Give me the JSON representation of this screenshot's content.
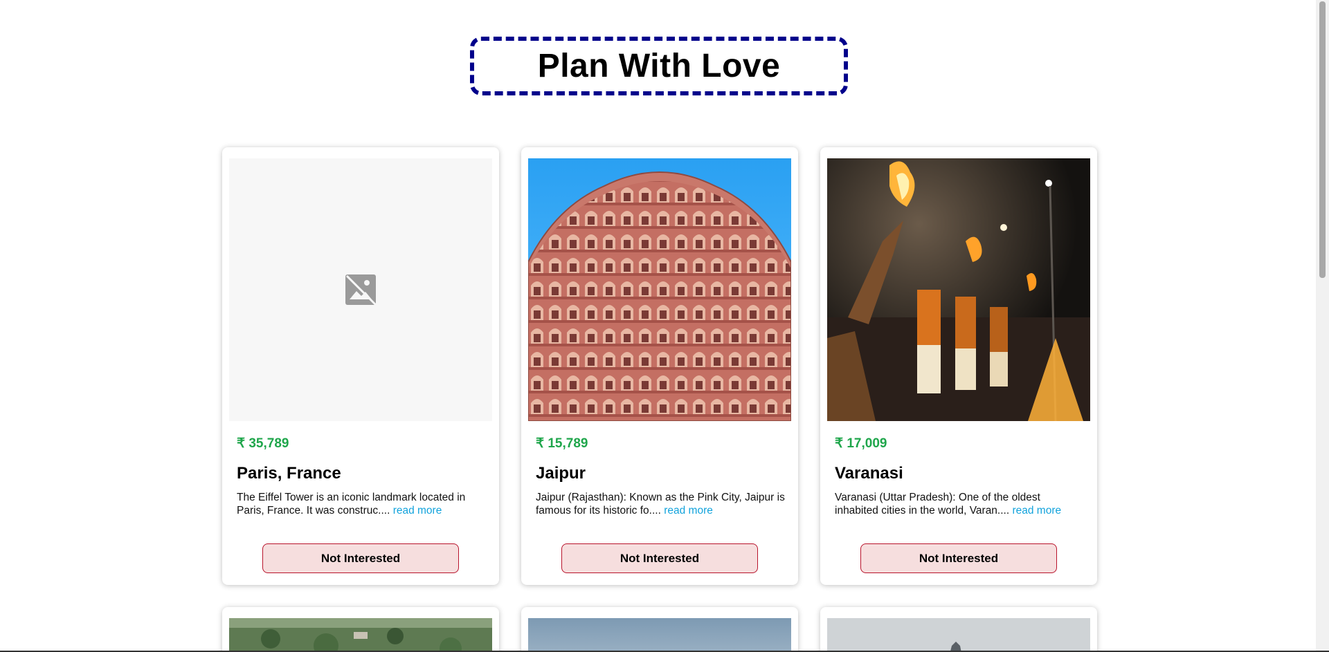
{
  "header": {
    "title": "Plan With Love"
  },
  "tours": [
    {
      "price": "₹ 35,789",
      "name": "Paris, France",
      "description": "The Eiffel Tower is an iconic landmark located in Paris, France. It was construc....",
      "read_more": "read more",
      "button": "Not Interested",
      "image": "broken-image-icon"
    },
    {
      "price": "₹ 15,789",
      "name": "Jaipur",
      "description": "Jaipur (Rajasthan): Known as the Pink City, Jaipur is famous for its historic fo....",
      "read_more": "read more",
      "button": "Not Interested",
      "image": "hawa-mahal-photo"
    },
    {
      "price": "₹ 17,009",
      "name": "Varanasi",
      "description": "Varanasi (Uttar Pradesh): One of the oldest inhabited cities in the world, Varan....",
      "read_more": "read more",
      "button": "Not Interested",
      "image": "ganga-aarti-photo"
    }
  ],
  "colors": {
    "price": "#1fa64b",
    "link": "#12a3dc",
    "title_border": "#00008b",
    "button_bg": "#f6dede",
    "button_border": "#b8132b"
  }
}
